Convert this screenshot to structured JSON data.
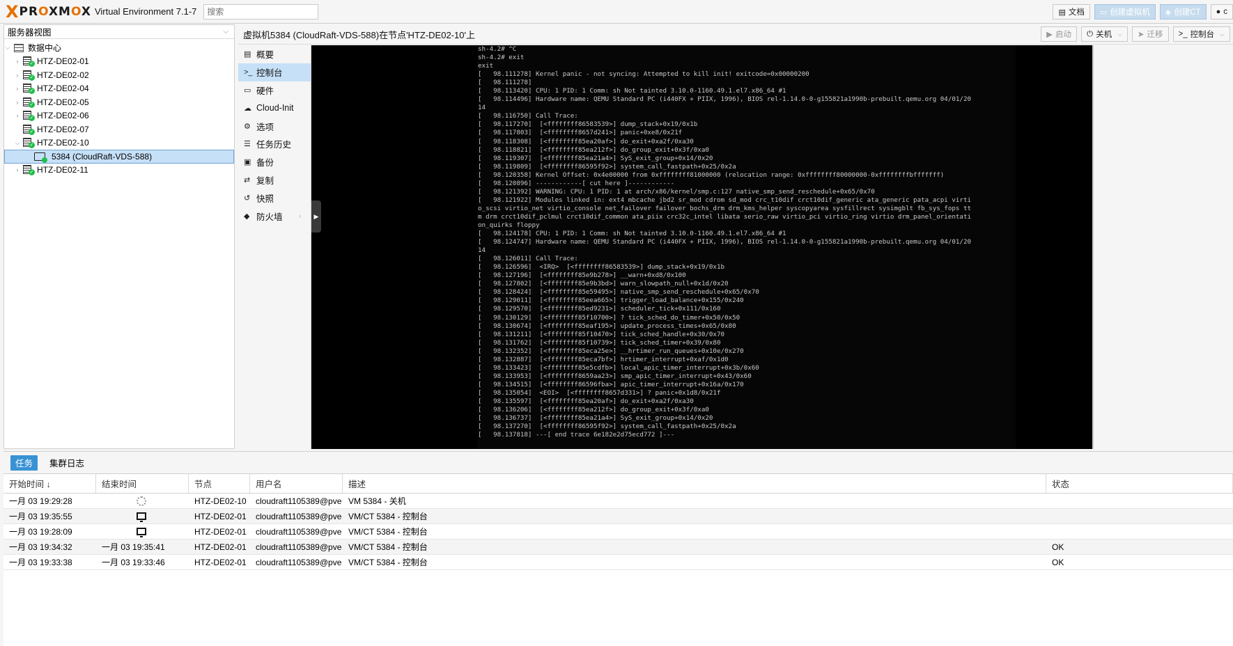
{
  "topbar": {
    "logo_x": "X",
    "logo_pro": "PR",
    "logo_o1": "O",
    "logo_xm": "XM",
    "logo_o2": "O",
    "logo_x2": "X",
    "version": "Virtual Environment 7.1-7",
    "search_placeholder": "搜索",
    "buttons": {
      "docs": "文档",
      "create_vm": "创建虚拟机",
      "create_ct": "创建CT",
      "user": "c"
    }
  },
  "left": {
    "view_label": "服务器视图",
    "datacenter": "数据中心",
    "nodes": [
      "HTZ-DE02-01",
      "HTZ-DE02-02",
      "HTZ-DE02-04",
      "HTZ-DE02-05",
      "HTZ-DE02-06",
      "HTZ-DE02-07",
      "HTZ-DE02-10"
    ],
    "vm": "5384 (CloudRaft-VDS-588)",
    "last_node": "HTZ-DE02-11"
  },
  "content": {
    "title": "虚拟机5384 (CloudRaft-VDS-588)在节点'HTZ-DE02-10'上",
    "buttons": {
      "start": "启动",
      "shutdown": "关机",
      "migrate": "迁移",
      "console": "控制台"
    }
  },
  "subnav": [
    "概要",
    "控制台",
    "硬件",
    "Cloud-Init",
    "选项",
    "任务历史",
    "备份",
    "复制",
    "快照",
    "防火墙"
  ],
  "console_text": "sh-4.2# ^C\nsh-4.2# exit\nexit\n[   98.111278] Kernel panic - not syncing: Attempted to kill init! exitcode=0x00000200\n[   98.111278]\n[   98.113420] CPU: 1 PID: 1 Comm: sh Not tainted 3.10.0-1160.49.1.el7.x86_64 #1\n[   98.114496] Hardware name: QEMU Standard PC (i440FX + PIIX, 1996), BIOS rel-1.14.0-0-g155821a1990b-prebuilt.qemu.org 04/01/20\n14\n[   98.116750] Call Trace:\n[   98.117270]  [<ffffffff86583539>] dump_stack+0x19/0x1b\n[   98.117803]  [<ffffffff8657d241>] panic+0xe8/0x21f\n[   98.118308]  [<ffffffff85ea20af>] do_exit+0xa2f/0xa30\n[   98.118821]  [<ffffffff85ea212f>] do_group_exit+0x3f/0xa0\n[   98.119307]  [<ffffffff85ea21a4>] SyS_exit_group+0x14/0x20\n[   98.119809]  [<ffffffff86595f92>] system_call_fastpath+0x25/0x2a\n[   98.120358] Kernel Offset: 0x4e00000 from 0xffffffff81000000 (relocation range: 0xffffffff80000000-0xffffffffbfffffff)\n[   98.120896] ------------[ cut here ]------------\n[   98.121392] WARNING: CPU: 1 PID: 1 at arch/x86/kernel/smp.c:127 native_smp_send_reschedule+0x65/0x70\n[   98.121922] Modules linked in: ext4 mbcache jbd2 sr_mod cdrom sd_mod crc_t10dif crct10dif_generic ata_generic pata_acpi virti\no_scsi virtio_net virtio_console net_failover failover bochs_drm drm_kms_helper syscopyarea sysfillrect sysimgblt fb_sys_fops tt\nm drm crct10dif_pclmul crct10dif_common ata_piix crc32c_intel libata serio_raw virtio_pci virtio_ring virtio drm_panel_orientati\non_quirks floppy\n[   98.124178] CPU: 1 PID: 1 Comm: sh Not tainted 3.10.0-1160.49.1.el7.x86_64 #1\n[   98.124747] Hardware name: QEMU Standard PC (i440FX + PIIX, 1996), BIOS rel-1.14.0-0-g155821a1990b-prebuilt.qemu.org 04/01/20\n14\n[   98.126011] Call Trace:\n[   98.126596]  <IRQ>  [<ffffffff86583539>] dump_stack+0x19/0x1b\n[   98.127196]  [<ffffffff85e9b278>] __warn+0xd8/0x100\n[   98.127802]  [<ffffffff85e9b3bd>] warn_slowpath_null+0x1d/0x20\n[   98.128424]  [<ffffffff85e59495>] native_smp_send_reschedule+0x65/0x70\n[   98.129011]  [<ffffffff85eea665>] trigger_load_balance+0x155/0x240\n[   98.129570]  [<ffffffff85ed9231>] scheduler_tick+0x111/0x160\n[   98.130129]  [<ffffffff85f10700>] ? tick_sched_do_timer+0x50/0x50\n[   98.130674]  [<ffffffff85eaf195>] update_process_times+0x65/0x80\n[   98.131211]  [<ffffffff85f10470>] tick_sched_handle+0x30/0x70\n[   98.131762]  [<ffffffff85f10739>] tick_sched_timer+0x39/0x80\n[   98.132352]  [<ffffffff85eca25e>] __hrtimer_run_queues+0x10e/0x270\n[   98.132887]  [<ffffffff85eca7bf>] hrtimer_interrupt+0xaf/0x1d0\n[   98.133423]  [<ffffffff85e5cdfb>] local_apic_timer_interrupt+0x3b/0x60\n[   98.133953]  [<ffffffff8659aa23>] smp_apic_timer_interrupt+0x43/0x60\n[   98.134515]  [<ffffffff86596fba>] apic_timer_interrupt+0x16a/0x170\n[   98.135054]  <EOI>  [<ffffffff8657d331>] ? panic+0x1d8/0x21f\n[   98.135597]  [<ffffffff85ea20af>] do_exit+0xa2f/0xa30\n[   98.136206]  [<ffffffff85ea212f>] do_group_exit+0x3f/0xa0\n[   98.136737]  [<ffffffff85ea21a4>] SyS_exit_group+0x14/0x20\n[   98.137270]  [<ffffffff86595f92>] system_call_fastpath+0x25/0x2a\n[   98.137818] ---[ end trace 6e182e2d75ecd772 ]---",
  "bottom": {
    "tabs": [
      "任务",
      "集群日志"
    ],
    "columns": [
      "开始时间 ↓",
      "结束时间",
      "节点",
      "用户名",
      "描述",
      "状态"
    ],
    "rows": [
      {
        "start": "一月 03 19:29:28",
        "end": "",
        "end_icon": "spinner-icon",
        "node": "HTZ-DE02-10",
        "user": "cloudraft1105389@pve",
        "desc": "VM 5384 - 关机",
        "status": ""
      },
      {
        "start": "一月 03 19:35:55",
        "end": "",
        "end_icon": "monitor-icon",
        "node": "HTZ-DE02-01",
        "user": "cloudraft1105389@pve",
        "desc": "VM/CT 5384 - 控制台",
        "status": ""
      },
      {
        "start": "一月 03 19:28:09",
        "end": "",
        "end_icon": "monitor-icon",
        "node": "HTZ-DE02-01",
        "user": "cloudraft1105389@pve",
        "desc": "VM/CT 5384 - 控制台",
        "status": ""
      },
      {
        "start": "一月 03 19:34:32",
        "end": "一月 03 19:35:41",
        "end_icon": "",
        "node": "HTZ-DE02-01",
        "user": "cloudraft1105389@pve",
        "desc": "VM/CT 5384 - 控制台",
        "status": "OK"
      },
      {
        "start": "一月 03 19:33:38",
        "end": "一月 03 19:33:46",
        "end_icon": "",
        "node": "HTZ-DE02-01",
        "user": "cloudraft1105389@pve",
        "desc": "VM/CT 5384 - 控制台",
        "status": "OK"
      }
    ]
  }
}
